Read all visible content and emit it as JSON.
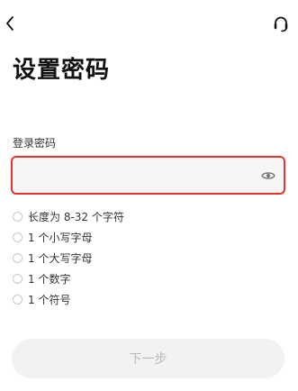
{
  "header": {
    "back_icon": "chevron-left-icon",
    "support_icon": "headset-icon"
  },
  "title": "设置密码",
  "password": {
    "label": "登录密码",
    "value": "",
    "placeholder": "",
    "visibility_icon": "eye-icon",
    "border_color": "#e8352a"
  },
  "rules": [
    {
      "text": "长度为 8-32 个字符"
    },
    {
      "text": "1 个小写字母"
    },
    {
      "text": "1 个大写字母"
    },
    {
      "text": "1 个数字"
    },
    {
      "text": "1 个符号"
    }
  ],
  "next_button": {
    "label": "下一步"
  }
}
